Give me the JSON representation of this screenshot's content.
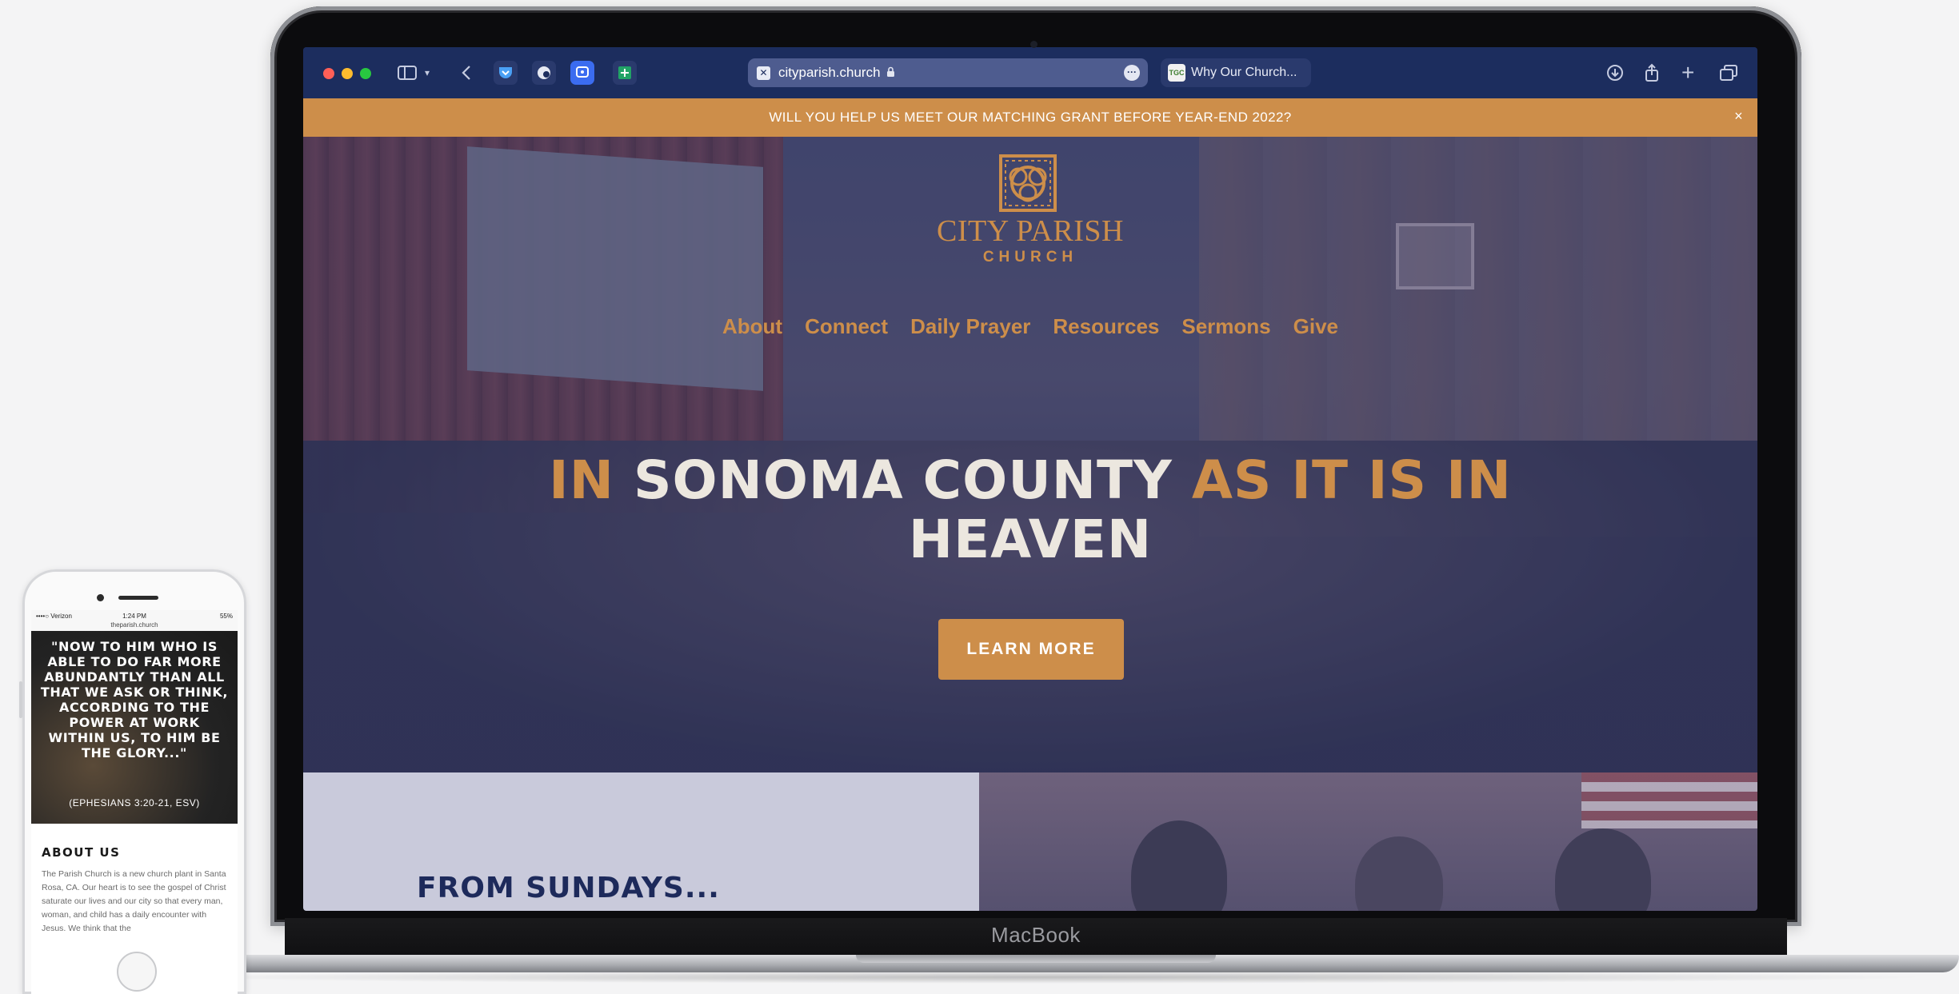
{
  "device": {
    "laptop_label": "MacBook"
  },
  "browser": {
    "address_bar": {
      "url": "cityparish.church"
    },
    "second_tab": {
      "title": "Why Our Church...",
      "favicon_text": "TGC"
    },
    "icons": [
      "sidebar-icon",
      "chevron-down-icon",
      "back-icon",
      "pocket-icon",
      "extension-icon",
      "extension-icon",
      "extension-icon",
      "download-icon",
      "share-icon",
      "plus-icon",
      "tabs-icon"
    ]
  },
  "site": {
    "banner": {
      "text": "WILL YOU HELP US MEET OUR MATCHING GRANT BEFORE YEAR-END 2022?",
      "close": "×"
    },
    "logo": {
      "name": "CITY PARISH",
      "sub": "CHURCH"
    },
    "nav": [
      "About",
      "Connect",
      "Daily Prayer",
      "Resources",
      "Sermons",
      "Give"
    ],
    "hero": {
      "headline_part1": "IN",
      "headline_part2": "SONOMA COUNTY",
      "headline_part3": "AS IT IS IN",
      "headline_part4": "HEAVEN",
      "cta": "LEARN MORE"
    },
    "section_heading": "FROM SUNDAYS...",
    "colors": {
      "accent": "#cd8e4a",
      "navy": "#1c2d5e",
      "section_bg": "#c9cadb"
    }
  },
  "phone": {
    "status": {
      "carrier": "••••○ Verizon",
      "time": "1:24 PM",
      "battery": "55%",
      "url": "theparish.church"
    },
    "quote": "\"NOW TO HIM WHO IS ABLE TO DO FAR MORE ABUNDANTLY THAN ALL THAT WE ASK OR THINK, ACCORDING TO THE POWER AT WORK WITHIN US, TO HIM BE THE GLORY...\"",
    "reference": "(EPHESIANS 3:20-21, ESV)",
    "about_heading": "ABOUT US",
    "about_body": "The Parish Church is a new church plant in Santa Rosa, CA. Our heart is to see the gospel of Christ saturate our lives and our city so that every man, woman, and child has a daily encounter with Jesus. We think that the"
  }
}
